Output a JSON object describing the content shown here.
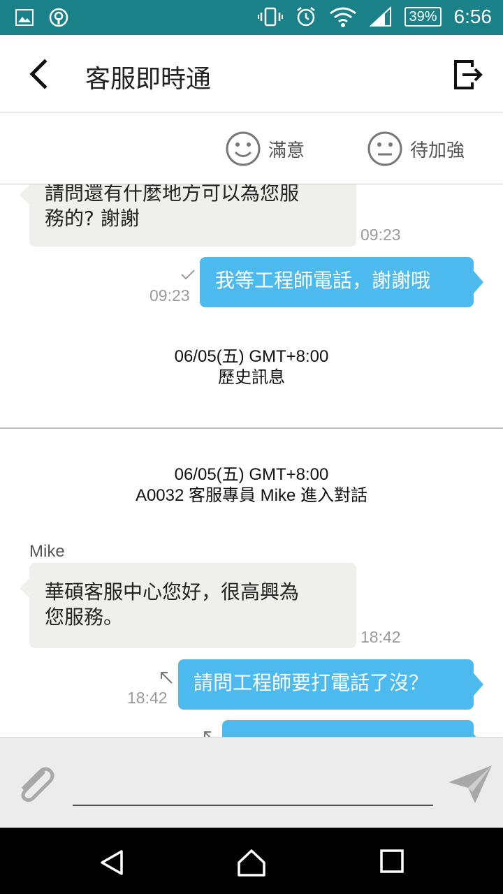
{
  "status_bar": {
    "time": "6:56",
    "battery": "39%",
    "icons": [
      "image-icon",
      "broadcast-icon",
      "vibrate-icon",
      "alarm-icon",
      "wifi-icon",
      "signal-icon",
      "battery-icon"
    ]
  },
  "app_bar": {
    "title": "客服即時通",
    "back_icon": "chevron-left-icon",
    "exit_icon": "exit-icon"
  },
  "rating": {
    "satisfied_label": "滿意",
    "improve_label": "待加強"
  },
  "messages": {
    "m1": {
      "line1": "請問還有什麼地方可以為您服",
      "line2": "務的? 謝謝",
      "time": "09:23"
    },
    "m2": {
      "text": "我等工程師電話，謝謝哦",
      "time": "09:23"
    },
    "sys1": {
      "line1": "06/05(五)  GMT+8:00",
      "line2": "歷史訊息"
    },
    "sys2": {
      "line1": "06/05(五)  GMT+8:00",
      "line2": "A0032 客服專員 Mike 進入對話"
    },
    "sender": "Mike",
    "m3": {
      "line1": "華碩客服中心您好，很高興為",
      "line2": "您服務。",
      "time": "18:42"
    },
    "m4": {
      "text": "請問工程師要打電話了沒？",
      "time": "18:42"
    }
  },
  "input": {
    "placeholder": "",
    "value": ""
  },
  "colors": {
    "status_bar": "#1b8188",
    "outgoing_bubble": "#4cb9ef",
    "incoming_bubble": "#efefed"
  }
}
